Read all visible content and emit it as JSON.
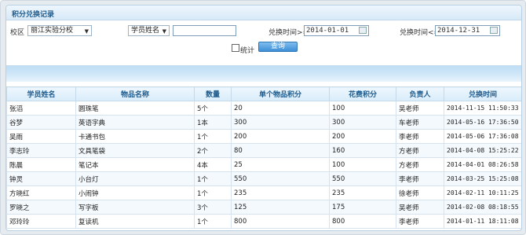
{
  "title": "积分兑换记录",
  "filters": {
    "campus_label": "校区",
    "campus_value": "丽江实验分校",
    "student_field": "学员姓名",
    "student_value": "",
    "time_from_label": "兑换时间>=",
    "time_from_value": "2014-01-01",
    "time_to_label": "兑换时间<=",
    "time_to_value": "2014-12-31",
    "stats_label": "统计",
    "query_label": "查询"
  },
  "table": {
    "columns": [
      "学员姓名",
      "物品名称",
      "数量",
      "单个物品积分",
      "花费积分",
      "负责人",
      "兑换时间"
    ],
    "rows": [
      [
        "张滔",
        "圆珠笔",
        "5个",
        "20",
        "100",
        "吴老师",
        "2014-11-15 11:50:33"
      ],
      [
        "谷梦",
        "英语字典",
        "1本",
        "300",
        "300",
        "车老师",
        "2014-05-16 17:36:50"
      ],
      [
        "吴雨",
        "卡通书包",
        "1个",
        "200",
        "200",
        "李老师",
        "2014-05-06 17:36:08"
      ],
      [
        "李志玲",
        "文具笔袋",
        "2个",
        "80",
        "160",
        "方老师",
        "2014-04-08 15:25:22"
      ],
      [
        "陈晨",
        "笔记本",
        "4本",
        "25",
        "100",
        "方老师",
        "2014-04-01 08:26:58"
      ],
      [
        "钟灵",
        "小台灯",
        "1个",
        "550",
        "550",
        "李老师",
        "2014-03-25 15:25:08"
      ],
      [
        "方晓红",
        "小闹钟",
        "1个",
        "235",
        "235",
        "徐老师",
        "2014-02-11 10:11:25"
      ],
      [
        "罗晓之",
        "写字板",
        "3个",
        "125",
        "175",
        "吴老师",
        "2014-02-08 08:18:55"
      ],
      [
        "邓玲玲",
        "复读机",
        "1个",
        "800",
        "800",
        "李老师",
        "2014-01-11 18:11:08"
      ]
    ]
  }
}
